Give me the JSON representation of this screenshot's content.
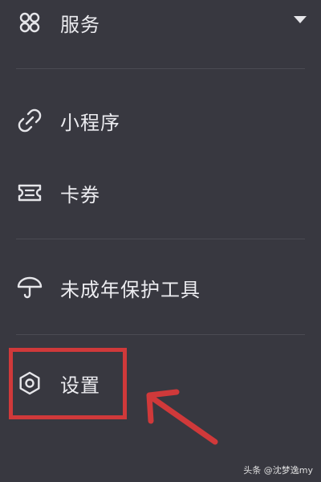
{
  "menu": {
    "services": {
      "label": "服务",
      "icon": "grid-icon"
    },
    "mini_programs": {
      "label": "小程序",
      "icon": "link-icon"
    },
    "cards": {
      "label": "卡券",
      "icon": "ticket-icon"
    },
    "minor_protection": {
      "label": "未成年保护工具",
      "icon": "umbrella-icon"
    },
    "settings": {
      "label": "设置",
      "icon": "gear-icon"
    }
  },
  "watermark": "头条 @沈梦逸my",
  "colors": {
    "background": "#383840",
    "text": "#ececf0",
    "divider": "#4b4b53",
    "highlight": "#d0393a"
  }
}
